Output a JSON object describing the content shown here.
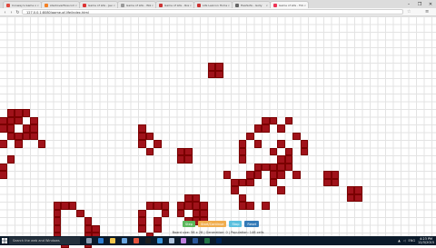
{
  "browser": {
    "tabs": [
      {
        "title": "Conway's Game of Life",
        "color": "#e04a3f",
        "active": false
      },
      {
        "title": "stackoverflow.com",
        "color": "#f48024",
        "active": false
      },
      {
        "title": "Game of Life - JavaScript",
        "color": "#d33",
        "active": false
      },
      {
        "title": "Game of Life - Wikipedia",
        "color": "#999",
        "active": false
      },
      {
        "title": "Game of Life - Rosetta",
        "color": "#c33",
        "active": false
      },
      {
        "title": "Life Lexicon Home Page",
        "color": "#c33",
        "active": false
      },
      {
        "title": "HashLife - Golly",
        "color": "#666",
        "active": false
      },
      {
        "title": "Game of Life - Fiddle",
        "color": "#e35",
        "active": true
      }
    ],
    "url": "127.0.0.1:8080/game-of-life/index.html",
    "window_controls": [
      "–",
      "❐",
      "✕"
    ]
  },
  "game": {
    "live_color": "#a0121a",
    "live_cells": [
      [
        27,
        6
      ],
      [
        28,
        6
      ],
      [
        27,
        7
      ],
      [
        28,
        7
      ],
      [
        1,
        12
      ],
      [
        2,
        12
      ],
      [
        3,
        12
      ],
      [
        0,
        13
      ],
      [
        1,
        13
      ],
      [
        2,
        13
      ],
      [
        4,
        13
      ],
      [
        0,
        14
      ],
      [
        1,
        14
      ],
      [
        3,
        14
      ],
      [
        4,
        14
      ],
      [
        1,
        15
      ],
      [
        2,
        15
      ],
      [
        3,
        15
      ],
      [
        4,
        15
      ],
      [
        0,
        16
      ],
      [
        2,
        16
      ],
      [
        5,
        16
      ],
      [
        1,
        18
      ],
      [
        0,
        19
      ],
      [
        0,
        20
      ],
      [
        18,
        14
      ],
      [
        18,
        15
      ],
      [
        19,
        15
      ],
      [
        18,
        16
      ],
      [
        20,
        16
      ],
      [
        19,
        17
      ],
      [
        23,
        17
      ],
      [
        24,
        17
      ],
      [
        23,
        18
      ],
      [
        24,
        18
      ],
      [
        34,
        13
      ],
      [
        35,
        13
      ],
      [
        37,
        13
      ],
      [
        33,
        14
      ],
      [
        34,
        14
      ],
      [
        36,
        14
      ],
      [
        32,
        15
      ],
      [
        38,
        15
      ],
      [
        31,
        16
      ],
      [
        33,
        16
      ],
      [
        36,
        16
      ],
      [
        39,
        16
      ],
      [
        31,
        17
      ],
      [
        35,
        17
      ],
      [
        37,
        17
      ],
      [
        39,
        17
      ],
      [
        31,
        18
      ],
      [
        36,
        18
      ],
      [
        37,
        18
      ],
      [
        33,
        19
      ],
      [
        34,
        19
      ],
      [
        35,
        19
      ],
      [
        36,
        19
      ],
      [
        37,
        19
      ],
      [
        29,
        20
      ],
      [
        32,
        20
      ],
      [
        33,
        20
      ],
      [
        35,
        20
      ],
      [
        36,
        20
      ],
      [
        38,
        20
      ],
      [
        30,
        21
      ],
      [
        31,
        21
      ],
      [
        32,
        21
      ],
      [
        35,
        21
      ],
      [
        42,
        20
      ],
      [
        43,
        20
      ],
      [
        42,
        21
      ],
      [
        43,
        21
      ],
      [
        30,
        22
      ],
      [
        36,
        22
      ],
      [
        45,
        22
      ],
      [
        46,
        22
      ],
      [
        31,
        23
      ],
      [
        45,
        23
      ],
      [
        46,
        23
      ],
      [
        31,
        24
      ],
      [
        32,
        24
      ],
      [
        34,
        24
      ],
      [
        7,
        24
      ],
      [
        8,
        24
      ],
      [
        9,
        24
      ],
      [
        7,
        25
      ],
      [
        10,
        25
      ],
      [
        7,
        26
      ],
      [
        11,
        26
      ],
      [
        7,
        27
      ],
      [
        11,
        27
      ],
      [
        12,
        27
      ],
      [
        7,
        28
      ],
      [
        11,
        28
      ],
      [
        12,
        28
      ],
      [
        8,
        29
      ],
      [
        11,
        29
      ],
      [
        19,
        24
      ],
      [
        20,
        24
      ],
      [
        21,
        24
      ],
      [
        18,
        25
      ],
      [
        21,
        25
      ],
      [
        18,
        26
      ],
      [
        20,
        26
      ],
      [
        18,
        27
      ],
      [
        20,
        27
      ],
      [
        19,
        28
      ],
      [
        24,
        23
      ],
      [
        25,
        23
      ],
      [
        23,
        24
      ],
      [
        24,
        24
      ],
      [
        25,
        24
      ],
      [
        26,
        24
      ],
      [
        23,
        25
      ],
      [
        25,
        25
      ],
      [
        26,
        25
      ],
      [
        24,
        26
      ],
      [
        25,
        26
      ],
      [
        26,
        26
      ]
    ]
  },
  "controls": [
    {
      "label": "Step",
      "color": "#5cb85c"
    },
    {
      "label": "Start/Continue",
      "color": "#f0ad4e"
    },
    {
      "label": "Stop",
      "color": "#5bc0de"
    },
    {
      "label": "Reset",
      "color": "#337ab7"
    }
  ],
  "status": "Board size: 56 x 28 | Generation: 0 | Population: 146 cells",
  "taskbar": {
    "search_placeholder": "Search the web and Windows",
    "apps": [
      {
        "name": "task-view-icon",
        "color": "#8a9ab0"
      },
      {
        "name": "edge-icon",
        "color": "#2d7dd2"
      },
      {
        "name": "file-explorer-icon",
        "color": "#f3c64a"
      },
      {
        "name": "store-icon",
        "color": "#6aa6e0"
      },
      {
        "name": "chrome-icon",
        "color": "#e5533d"
      },
      {
        "name": "terminal-icon",
        "color": "#1e1e1e"
      },
      {
        "name": "vscode-icon",
        "color": "#3a96dd"
      },
      {
        "name": "notepad-icon",
        "color": "#b0c4de"
      },
      {
        "name": "paint-icon",
        "color": "#c080e0"
      },
      {
        "name": "word-icon",
        "color": "#2b579a"
      },
      {
        "name": "excel-icon",
        "color": "#217346"
      },
      {
        "name": "powershell-icon",
        "color": "#012456"
      }
    ],
    "tray_lang": "ENG",
    "time": "4:23 PM",
    "date": "12/3/2015"
  }
}
